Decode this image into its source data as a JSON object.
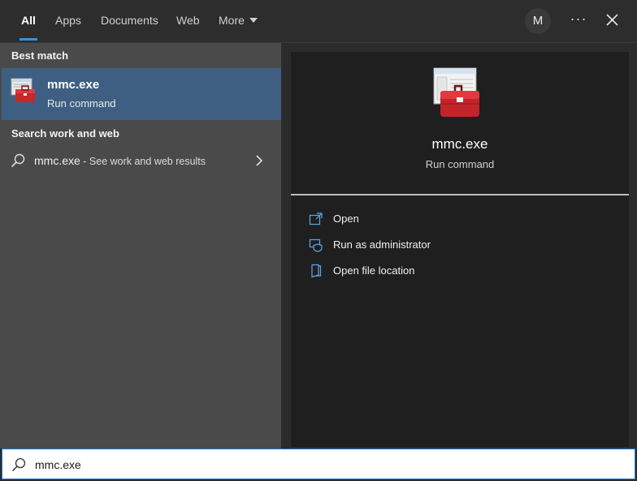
{
  "tabs": [
    {
      "label": "All",
      "active": true
    },
    {
      "label": "Apps"
    },
    {
      "label": "Documents"
    },
    {
      "label": "Web"
    },
    {
      "label": "More"
    }
  ],
  "account": {
    "initial": "M"
  },
  "toolbar": {
    "more_options": "···"
  },
  "left": {
    "best_match_header": "Best match",
    "best_match": {
      "title": "mmc.exe",
      "subtitle": "Run command",
      "icon": "toolbox-icon"
    },
    "web_header": "Search work and web",
    "web_result": {
      "query": "mmc.exe",
      "suffix": " - See work and web results"
    }
  },
  "preview": {
    "title": "mmc.exe",
    "subtitle": "Run command",
    "actions": [
      {
        "label": "Open",
        "icon": "open-icon"
      },
      {
        "label": "Run as administrator",
        "icon": "shield-icon"
      },
      {
        "label": "Open file location",
        "icon": "folder-location-icon"
      }
    ]
  },
  "search": {
    "value": "mmc.exe"
  },
  "colors": {
    "accent": "#3a8fde",
    "selected": "#3e5f82"
  }
}
